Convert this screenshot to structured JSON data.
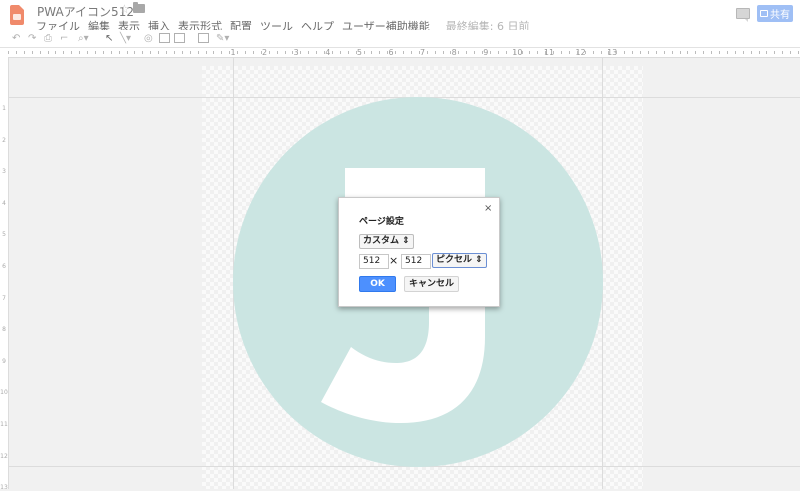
{
  "app": {
    "title": "PWAアイコン512",
    "menus": [
      "ファイル",
      "編集",
      "表示",
      "挿入",
      "表示形式",
      "配置",
      "ツール",
      "ヘルプ",
      "ユーザー補助機能"
    ],
    "last_edit": "最終編集: 6 日前",
    "share_label": "共有"
  },
  "toolbar": {
    "icons": [
      "undo-icon",
      "redo-icon",
      "print-icon",
      "paint-format-icon",
      "zoom-icon",
      "select-icon",
      "line-icon",
      "shape-icon",
      "textbox-icon",
      "image-icon",
      "comment-add-icon",
      "pen-icon"
    ]
  },
  "ruler": {
    "h_ticks": [
      "1",
      "2",
      "3",
      "4",
      "5",
      "6",
      "7",
      "8",
      "9",
      "10",
      "11",
      "12",
      "13"
    ],
    "v_ticks": [
      "1",
      "2",
      "3",
      "4",
      "5",
      "6",
      "7",
      "8",
      "9",
      "10",
      "11",
      "12",
      "13"
    ]
  },
  "canvas": {
    "circle_color": "#cbe5e2",
    "letter": "J",
    "letter_color": "#ffffff"
  },
  "dialog": {
    "title": "ページ設定",
    "close": "×",
    "preset": "カスタム",
    "width": "512",
    "times": "×",
    "height": "512",
    "unit": "ピクセル",
    "ok_label": "OK",
    "cancel_label": "キャンセル"
  },
  "colors": {
    "accent": "#4d90fe",
    "share": "#9fbff5",
    "doc_icon": "#f08a6b"
  }
}
